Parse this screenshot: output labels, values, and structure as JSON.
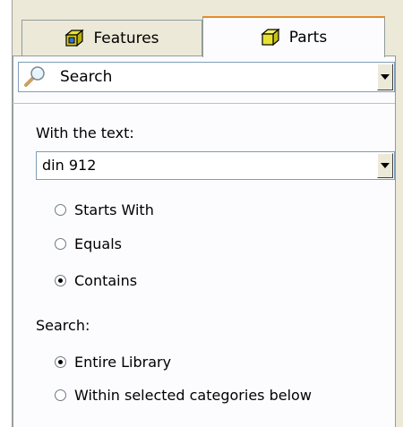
{
  "tabs": [
    {
      "label": "Features",
      "icon": "features-box-icon",
      "selected": false
    },
    {
      "label": "Parts",
      "icon": "parts-box-icon",
      "selected": true
    }
  ],
  "search_mode": {
    "value": "Search",
    "icon": "magnifier-icon"
  },
  "text_search": {
    "label": "With the text:",
    "value": "din 912",
    "match_options": [
      {
        "label": "Starts With",
        "selected": false
      },
      {
        "label": "Equals",
        "selected": false
      },
      {
        "label": "Contains",
        "selected": true
      }
    ]
  },
  "scope": {
    "label": "Search:",
    "options": [
      {
        "label": "Entire Library",
        "selected": true
      },
      {
        "label": "Within selected categories below",
        "selected": false
      }
    ]
  },
  "colors": {
    "tab_accent": "#e68b2c",
    "panel_bg": "#fcfcfe",
    "chrome_bg": "#ece9d8",
    "field_border": "#7f9db9"
  }
}
